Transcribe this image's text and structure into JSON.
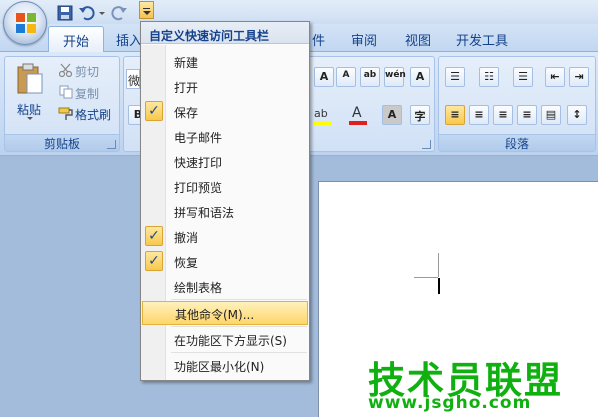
{
  "qat": {
    "customize_button": "customize-qat-dropdown",
    "icons": [
      "save-icon",
      "undo-icon",
      "redo-icon"
    ]
  },
  "tabs": [
    {
      "label": "开始"
    },
    {
      "label": "插入"
    },
    {
      "label": "件"
    },
    {
      "label": "审阅"
    },
    {
      "label": "视图"
    },
    {
      "label": "开发工具"
    }
  ],
  "ribbon": {
    "clipboard": {
      "paste_label": "粘贴",
      "cut_label": "剪切",
      "copy_label": "复制",
      "format_painter_label": "格式刷",
      "group_label": "剪贴板"
    },
    "font": {
      "font_name_partial": "微",
      "bold_label": "B"
    },
    "paragraph": {
      "group_label": "段落"
    }
  },
  "menu": {
    "title": "自定义快速访问工具栏",
    "items": [
      {
        "label": "新建",
        "checked": false
      },
      {
        "label": "打开",
        "checked": false
      },
      {
        "label": "保存",
        "checked": true
      },
      {
        "label": "电子邮件",
        "checked": false
      },
      {
        "label": "快速打印",
        "checked": false
      },
      {
        "label": "打印预览",
        "checked": false
      },
      {
        "label": "拼写和语法",
        "checked": false
      },
      {
        "label": "撤消",
        "checked": true
      },
      {
        "label": "恢复",
        "checked": true
      },
      {
        "label": "绘制表格",
        "checked": false
      }
    ],
    "more_commands": "其他命令(M)...",
    "show_below": "在功能区下方显示(S)",
    "minimize_ribbon": "功能区最小化(N)"
  },
  "watermark": {
    "title": "技术员联盟",
    "url": "www.jsgho.com"
  },
  "colors": {
    "highlight": "#fdd66b",
    "accent_text": "#15428b",
    "watermark": "#10b010"
  }
}
